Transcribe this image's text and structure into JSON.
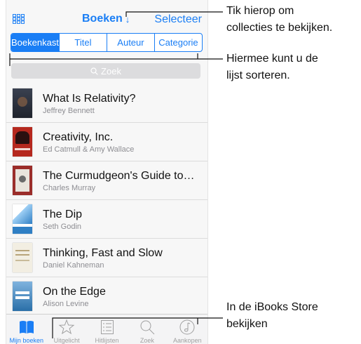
{
  "navbar": {
    "title": "Boeken",
    "select_label": "Selecteer"
  },
  "segments": [
    {
      "label": "Boekenkast",
      "active": true
    },
    {
      "label": "Titel",
      "active": false
    },
    {
      "label": "Auteur",
      "active": false
    },
    {
      "label": "Categorie",
      "active": false
    }
  ],
  "search": {
    "placeholder": "Zoek"
  },
  "books": [
    {
      "title": "What Is Relativity?",
      "author": "Jeffrey Bennett",
      "cover_color": "#2f3440"
    },
    {
      "title": "Creativity, Inc.",
      "author": "Ed Catmull & Amy Wallace",
      "cover_color": "#b5281e"
    },
    {
      "title": "The Curmudgeon's Guide to…",
      "author": "Charles Murray",
      "cover_color": "#9b2d2a"
    },
    {
      "title": "The Dip",
      "author": "Seth Godin",
      "cover_color": "#2f7fc4"
    },
    {
      "title": "Thinking, Fast and Slow",
      "author": "Daniel Kahneman",
      "cover_color": "#e8e3d5"
    },
    {
      "title": "On the Edge",
      "author": "Alison Levine",
      "cover_color": "#2a6fa8"
    }
  ],
  "tabbar": [
    {
      "label": "Mijn boeken",
      "icon": "book-icon",
      "active": true
    },
    {
      "label": "Uitgelicht",
      "icon": "star-icon",
      "active": false
    },
    {
      "label": "Hitlijsten",
      "icon": "list-icon",
      "active": false
    },
    {
      "label": "Zoek",
      "icon": "search-icon",
      "active": false
    },
    {
      "label": "Aankopen",
      "icon": "purchases-icon",
      "active": false
    }
  ],
  "callouts": [
    {
      "lines": [
        "Tik hierop om",
        "collecties te bekijken."
      ]
    },
    {
      "lines": [
        "Hiermee kunt u de",
        "lijst sorteren."
      ]
    },
    {
      "lines": [
        "In de iBooks Store",
        "bekijken"
      ]
    }
  ],
  "colors": {
    "accent": "#1a7ef5"
  }
}
